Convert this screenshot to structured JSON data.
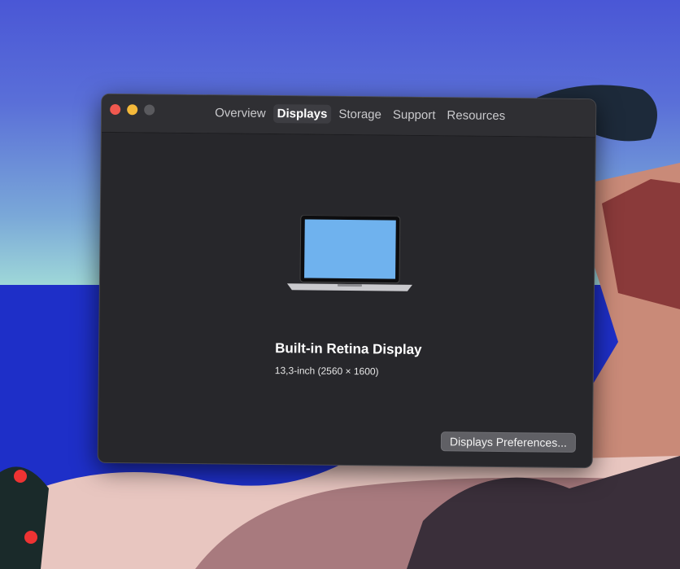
{
  "window": {
    "traffic_lights": {
      "close": "#f0584f",
      "minimize": "#f4b93a",
      "zoom": "#5a5a5e"
    },
    "tabs": [
      {
        "label": "Overview",
        "active": false
      },
      {
        "label": "Displays",
        "active": true
      },
      {
        "label": "Storage",
        "active": false
      },
      {
        "label": "Support",
        "active": false
      },
      {
        "label": "Resources",
        "active": false
      }
    ],
    "display": {
      "name": "Built-in Retina Display",
      "details": "13,3-inch (2560 × 1600)"
    },
    "preferences_button": "Displays Preferences..."
  }
}
